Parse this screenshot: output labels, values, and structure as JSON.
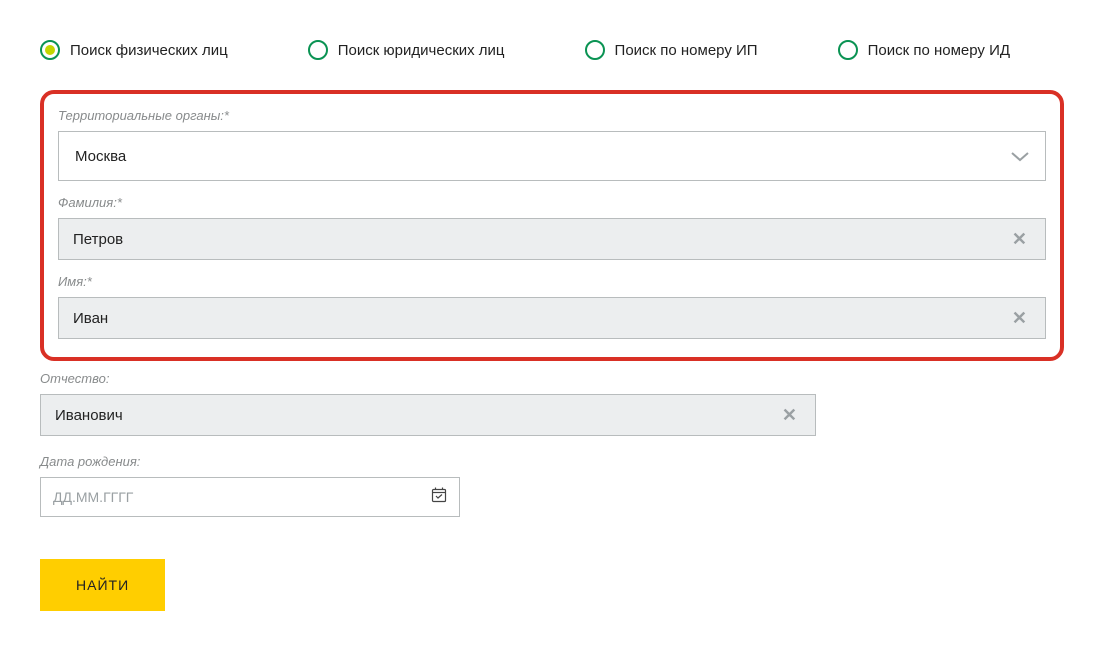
{
  "tabs": [
    {
      "label": "Поиск физических лиц",
      "selected": true
    },
    {
      "label": "Поиск юридических лиц",
      "selected": false
    },
    {
      "label": "Поиск по номеру ИП",
      "selected": false
    },
    {
      "label": "Поиск по номеру ИД",
      "selected": false
    }
  ],
  "form": {
    "territory": {
      "label": "Территориальные органы:*",
      "value": "Москва"
    },
    "lastname": {
      "label": "Фамилия:*",
      "value": "Петров"
    },
    "firstname": {
      "label": "Имя:*",
      "value": "Иван"
    },
    "patronymic": {
      "label": "Отчество:",
      "value": "Иванович"
    },
    "birthdate": {
      "label": "Дата рождения:",
      "placeholder": "ДД.ММ.ГГГГ"
    },
    "submit": "НАЙТИ"
  }
}
